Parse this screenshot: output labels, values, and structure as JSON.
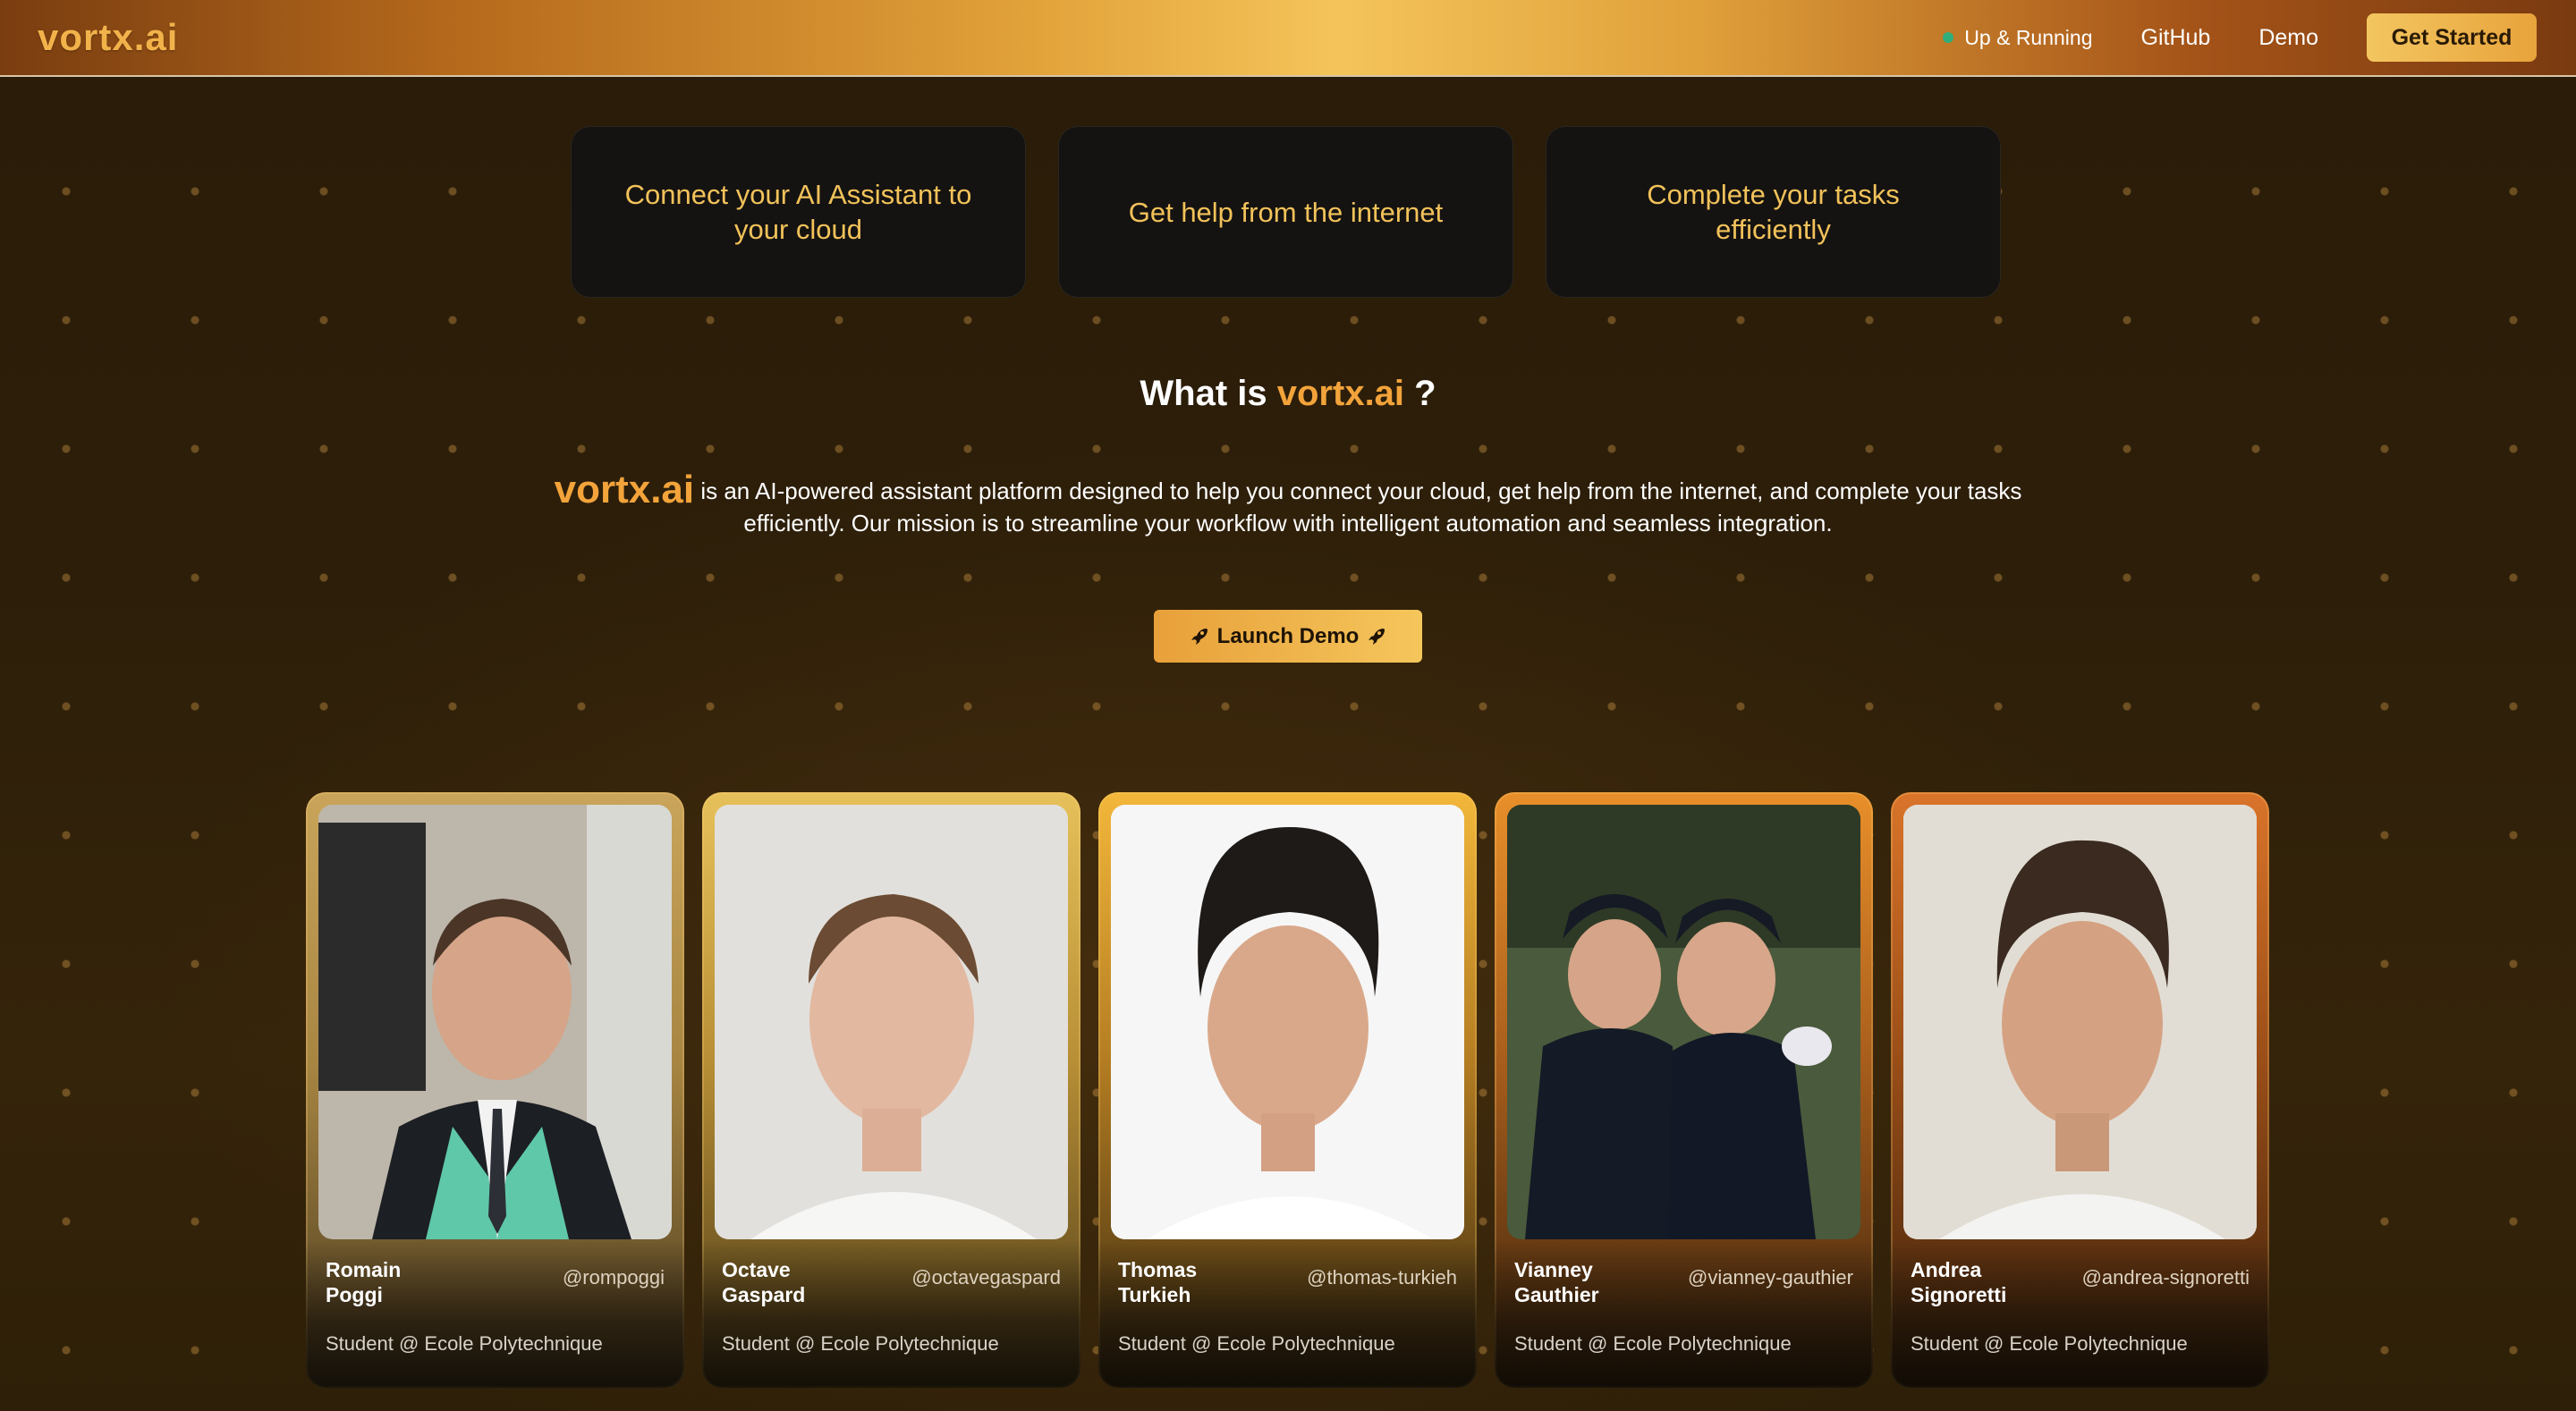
{
  "header": {
    "brand": "vortx.ai",
    "status": "Up & Running",
    "nav": [
      "GitHub",
      "Demo"
    ],
    "cta": "Get Started"
  },
  "features": [
    "Connect your AI Assistant to your cloud",
    "Get help from the internet",
    "Complete your tasks efficiently"
  ],
  "about": {
    "title_prefix": "What is",
    "title_brand": "vortx.ai",
    "title_suffix": "?",
    "brand": "vortx.ai",
    "description": "is an AI-powered assistant platform designed to help you connect your cloud, get help from the internet, and complete your tasks efficiently. Our mission is to streamline your workflow with intelligent automation and seamless integration.",
    "launch_label": "Launch Demo"
  },
  "team": [
    {
      "name": "Romain Poggi",
      "handle": "@rompoggi",
      "role": "Student @ Ecole Polytechnique"
    },
    {
      "name": "Octave Gaspard",
      "handle": "@octavegaspard",
      "role": "Student @ Ecole Polytechnique"
    },
    {
      "name": "Thomas Turkieh",
      "handle": "@thomas-turkieh",
      "role": "Student @ Ecole Polytechnique"
    },
    {
      "name": "Vianney Gauthier",
      "handle": "@vianney-gauthier",
      "role": "Student @ Ecole Polytechnique"
    },
    {
      "name": "Andrea Signoretti",
      "handle": "@andrea-signoretti",
      "role": "Student @ Ecole Polytechnique"
    }
  ],
  "colors": {
    "accent": "#f2a33a",
    "card_gradients": [
      "#d9b35a",
      "#e8b64a",
      "#f0b53a",
      "#e58a2a",
      "#d9742a"
    ]
  }
}
